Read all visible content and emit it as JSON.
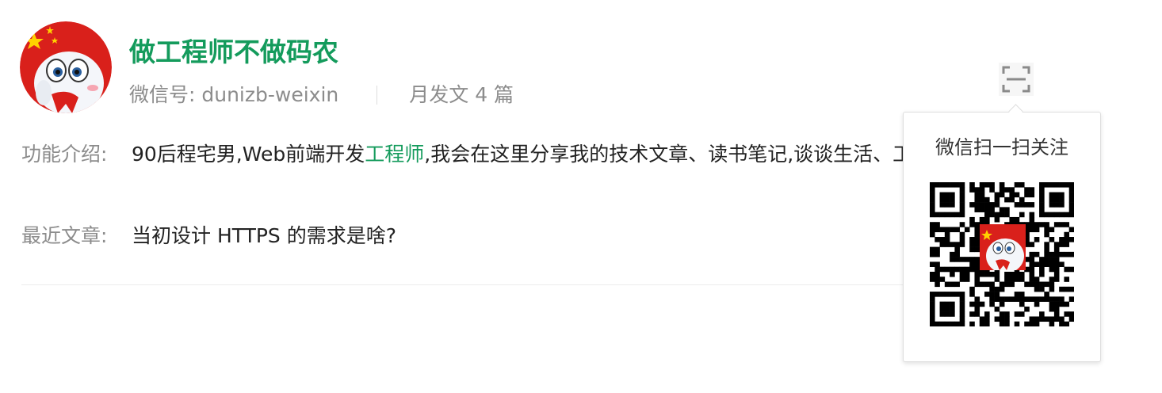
{
  "account": {
    "name": "做工程师不做码农",
    "wechat_id_label": "微信号: dunizb-weixin",
    "monthly_posts": "月发文 4 篇",
    "avatar_icon": "cartoon-mascot-avatar-icon"
  },
  "intro": {
    "label": "功能介绍:",
    "before": "90后程宅男,Web前端开发",
    "highlight": "工程师",
    "after": ",我会在这里分享我的技术文章、读书笔记,谈谈生活、工作等,欢迎交流"
  },
  "recent": {
    "label": "最近文章:",
    "article": "当初设计 HTTPS 的需求是啥?"
  },
  "qr_popup": {
    "title": "微信扫一扫关注",
    "scan_icon": "scan-qr-icon"
  },
  "colors": {
    "accent": "#149b5c",
    "muted": "#8c8c8c",
    "text": "#222222"
  }
}
